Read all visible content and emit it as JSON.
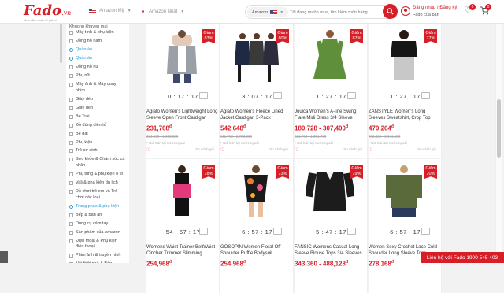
{
  "header": {
    "logo": "Fado",
    "logo_suffix": ".vn",
    "logo_tagline": "Mua sắm quốc tế giá tốt",
    "markets": [
      {
        "label": "Amazon Mỹ",
        "flag": "us-flag-icon"
      },
      {
        "label": "Amazon Nhật",
        "flag": "jp-flag-icon"
      }
    ],
    "search": {
      "market": "Amazon",
      "placeholder": "Tôi đang muốn mua, tìm kiếm món hàng..."
    },
    "login": "Đăng nhập / Đăng ký",
    "login_sub": "Fado của bạn",
    "wishlist_count": "0",
    "cart_count": "0"
  },
  "sidebar": {
    "heading": "Khuong khuyen mai",
    "items": [
      {
        "label": "Máy tính & phụ kiện",
        "checked": false
      },
      {
        "label": "Đồng hồ nam",
        "checked": false
      },
      {
        "label": "Quần áo",
        "checked": true
      },
      {
        "label": "Quần áo",
        "checked": true
      },
      {
        "label": "Đồng hồ nữ",
        "checked": false
      },
      {
        "label": "Phụ nữ",
        "checked": false
      },
      {
        "label": "Máy ảnh & Máy quay phim",
        "checked": false
      },
      {
        "label": "Giày dép",
        "checked": false
      },
      {
        "label": "Giày dép",
        "checked": false
      },
      {
        "label": "Bé Trai",
        "checked": false
      },
      {
        "label": "Đồ dùng điện tử",
        "checked": false
      },
      {
        "label": "Bé gái",
        "checked": false
      },
      {
        "label": "Phụ kiện",
        "checked": false
      },
      {
        "label": "Trẻ sơ sinh",
        "checked": false
      },
      {
        "label": "Sức khỏe & Chăm sóc cá nhân",
        "checked": false
      },
      {
        "label": "Phụ tùng & phụ kiện ô tô",
        "checked": false
      },
      {
        "label": "Vali & phụ kiện du lịch",
        "checked": false
      },
      {
        "label": "Đồ chơi trẻ em và Trò chơi các loại",
        "checked": false
      },
      {
        "label": "Trang phục & phụ kiện",
        "checked": true
      },
      {
        "label": "Bếp & bàn ăn",
        "checked": false
      },
      {
        "label": "Dụng cụ cầm tay",
        "checked": false
      },
      {
        "label": "Sản phẩm của Amazon",
        "checked": false
      },
      {
        "label": "Điện thoại & Phụ kiện điện thoại",
        "checked": false
      },
      {
        "label": "Phim ảnh & truyền hình",
        "checked": false
      },
      {
        "label": "Nội thất nhà & Bếp",
        "checked": false
      },
      {
        "label": "Nội thất",
        "checked": false
      }
    ]
  },
  "products": [
    {
      "discount_label": "Giảm",
      "discount": "83%",
      "timer": "0 : 17 : 17",
      "title": "Agiato Women's Lightweight Long Sleeve Open Front Cardigan",
      "price": "231,768",
      "old_price": "324,568 - 1,368,800",
      "note": "* Giá bán tại nước ngoài",
      "compare": "So sánh giá",
      "img": "cardigan"
    },
    {
      "discount_label": "Giảm",
      "discount": "80%",
      "timer": "3 : 07 : 17",
      "title": "Agiato Women's Fleece Lined Jacket Cardigan 3-Pack",
      "price": "542,648",
      "old_price": "611,768 - 2,760,000",
      "note": "* Giá bán tại nước ngoài",
      "compare": "So sánh giá",
      "img": "fleece"
    },
    {
      "discount_label": "Giảm",
      "discount": "87%",
      "timer": "1 : 27 : 17",
      "title": "Jouica Women's A-line Swing Flare Midi Dress 3/4 Sleeve",
      "price": "180,728 - 307,400",
      "old_price": "231,768 - 1,391,768",
      "note": "* Giá bán tại nước ngoài",
      "compare": "So sánh giá",
      "img": "dress"
    },
    {
      "discount_label": "Giảm",
      "discount": "77%",
      "timer": "1 : 27 : 17",
      "title": "ZANSTYLE Women's Long Sleeves Sweatshirt, Crop Top",
      "price": "470,264",
      "old_price": "902,028 - 2,041,600",
      "note": "* Giá bán tại nước ngoài",
      "compare": "So sánh giá",
      "img": "sweatshirt"
    },
    {
      "discount_label": "Giảm",
      "discount": "78%",
      "timer": "54 : 57 : 17",
      "title": "Womens Waist Trainer BeltWaist Cincher Trimmer Slimming",
      "price": "254,968",
      "old_price": "",
      "note": "",
      "compare": "",
      "img": "waist"
    },
    {
      "discount_label": "Giảm",
      "discount": "73%",
      "timer": "6 : 57 : 17",
      "title": "GOSOPIN Women Floral Off Shoulder Ruffle Bodysuit",
      "price": "254,968",
      "old_price": "",
      "note": "",
      "compare": "",
      "img": "floral"
    },
    {
      "discount_label": "Giảm",
      "discount": "79%",
      "timer": "5 : 47 : 17",
      "title": "FANSIC Womens Casual Long Sleeve Blouse Tops 3/4 Sleeves",
      "price": "343,360 - 488,128",
      "old_price": "",
      "note": "",
      "compare": "",
      "img": "blouse"
    },
    {
      "discount_label": "Giảm",
      "discount": "70%",
      "timer": "6 : 57 : 17",
      "title": "Women Sexy Crochet Lace Cold Shoulder Long Sleeve Tops",
      "price": "278,168",
      "old_price": "",
      "note": "",
      "compare": "",
      "img": "lace"
    }
  ],
  "currency_symbol": "đ",
  "hotline": "Liên hệ với Fado 1900 545 403",
  "colors": {
    "brand": "#d71f27",
    "accent_blue": "#2e9bd6"
  }
}
